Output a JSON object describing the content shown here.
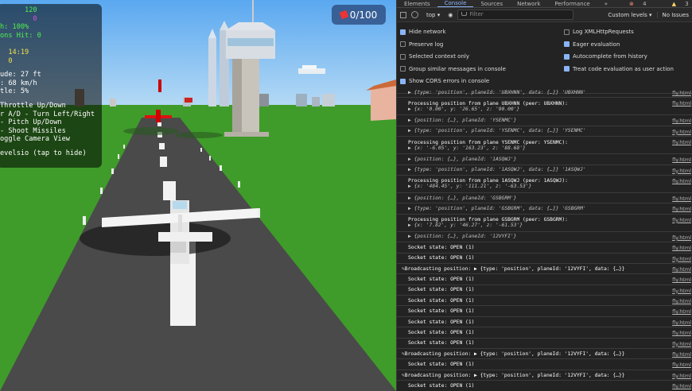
{
  "game": {
    "hud_lines": [
      {
        "text": "      120",
        "color": "g"
      },
      {
        "text": "        0",
        "color": "m"
      },
      {
        "text": "h: 100%",
        "color": "g"
      },
      {
        "text": "ons Hit: 0",
        "color": "g"
      },
      {
        "text": "         ",
        "color": "m"
      },
      {
        "text": "  14:19",
        "color": "y"
      },
      {
        "text": "  0",
        "color": "y"
      },
      {
        "text": "",
        "color": "gap"
      },
      {
        "text": "ude: 27 ft",
        "color": "w"
      },
      {
        "text": ": 68 km/h",
        "color": "w"
      },
      {
        "text": "tle: 5%",
        "color": "w"
      },
      {
        "text": "",
        "color": "gap"
      },
      {
        "text": "Throttle Up/Down",
        "color": "w"
      },
      {
        "text": "r A/D - Turn Left/Right",
        "color": "w"
      },
      {
        "text": "- Pitch Up/Down",
        "color": "w"
      },
      {
        "text": "- Shoot Missiles",
        "color": "w"
      },
      {
        "text": "oggle Camera View",
        "color": "w"
      },
      {
        "text": "",
        "color": "gap"
      },
      {
        "text": "evelsio (tap to hide)",
        "color": "w"
      }
    ],
    "score_text": "0/100"
  },
  "devtools": {
    "tabs": [
      "Elements",
      "Console",
      "Sources",
      "Network",
      "Performance",
      "»"
    ],
    "active_tab": "Console",
    "counts": {
      "errors": "4",
      "warnings": "3"
    },
    "toolbar": {
      "context": "top",
      "filter_placeholder": "Filter",
      "levels": "Custom levels ▾",
      "issues": "No Issues"
    },
    "settings_left": [
      {
        "label": "Hide network",
        "checked": true
      },
      {
        "label": "Preserve log",
        "checked": false
      },
      {
        "label": "Selected context only",
        "checked": false
      },
      {
        "label": "Group similar messages in console",
        "checked": false
      },
      {
        "label": "Show CORS errors in console",
        "checked": true
      }
    ],
    "settings_right": [
      {
        "label": "Log XMLHttpRequests",
        "checked": false
      },
      {
        "label": "Eager evaluation",
        "checked": true
      },
      {
        "label": "Autocomplete from history",
        "checked": true
      },
      {
        "label": "Treat code evaluation as user action",
        "checked": true
      }
    ],
    "log_rows": [
      {
        "kind": "obj",
        "text": "▶ {type: 'position', planeId: 'UBXHNN', data: {…}} 'UBXHNN'"
      },
      {
        "kind": "proc",
        "text": "Processing position from plane UBXHNN (peer: UBXHNN):",
        "sub": "▶ {x: '0.00', y: '26.65', z: '90.00'}"
      },
      {
        "kind": "obj",
        "text": "▶ {position: {…}, planeId: 'YSENMC'}"
      },
      {
        "kind": "obj",
        "text": "▶ {type: 'position', planeId: 'YSENMC', data: {…}} 'YSENMC'"
      },
      {
        "kind": "proc",
        "text": "Processing position from plane YSENMC (peer: YSENMC):",
        "sub": "▶ {x: '-6.05', y: '163.23', z: '88.68'}"
      },
      {
        "kind": "obj",
        "text": "▶ {position: {…}, planeId: '1ASQWJ'}"
      },
      {
        "kind": "obj",
        "text": "▶ {type: 'position', planeId: '1ASQWJ', data: {…}} '1ASQWJ'"
      },
      {
        "kind": "proc",
        "text": "Processing position from plane 1ASQWJ (peer: 1ASQWJ):",
        "sub": "▶ {x: '484.45', y: '111.21', z: '-63.53'}"
      },
      {
        "kind": "obj",
        "text": "▶ {position: {…}, planeId: 'GSBGRM'}"
      },
      {
        "kind": "obj",
        "text": "▶ {type: 'position', planeId: 'GSBGRM', data: {…}} 'GSBGRM'"
      },
      {
        "kind": "proc",
        "text": "Processing position from plane GSBGRM (peer: GSBGRM):",
        "sub": "▶ {x: '7.82', y: '46.27', z: '-61.53'}"
      },
      {
        "kind": "obj",
        "text": "▶ {position: {…}, planeId: '12VYFI'}"
      },
      {
        "kind": "plain",
        "text": "Socket state: OPEN (1)"
      },
      {
        "kind": "plain",
        "text": "Socket state: OPEN (1)"
      },
      {
        "kind": "bcast",
        "text": "Broadcasting position: ▶ {type: 'position', planeId: '12VYFI', data: {…}}"
      },
      {
        "kind": "plain",
        "text": "Socket state: OPEN (1)"
      },
      {
        "kind": "plain",
        "text": "Socket state: OPEN (1)"
      },
      {
        "kind": "plain",
        "text": "Socket state: OPEN (1)"
      },
      {
        "kind": "plain",
        "text": "Socket state: OPEN (1)"
      },
      {
        "kind": "plain",
        "text": "Socket state: OPEN (1)"
      },
      {
        "kind": "plain",
        "text": "Socket state: OPEN (1)"
      },
      {
        "kind": "plain",
        "text": "Socket state: OPEN (1)"
      },
      {
        "kind": "bcast",
        "text": "Broadcasting position: ▶ {type: 'position', planeId: '12VYFI', data: {…}}"
      },
      {
        "kind": "plain",
        "text": "Socket state: OPEN (1)"
      },
      {
        "kind": "bcast",
        "text": "Broadcasting position: ▶ {type: 'position', planeId: '12VYFI', data: {…}}"
      },
      {
        "kind": "plain",
        "text": "Socket state: OPEN (1)"
      },
      {
        "kind": "plain",
        "text": "Socket state: OPEN (1)"
      }
    ],
    "source_link": "fly.html"
  }
}
